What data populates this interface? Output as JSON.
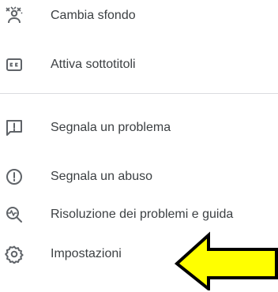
{
  "menu": {
    "items": [
      {
        "label": "Cambia sfondo",
        "icon": "change-background-icon"
      },
      {
        "label": "Attiva sottotitoli",
        "icon": "closed-captions-icon"
      },
      {
        "label": "Segnala un problema",
        "icon": "report-problem-icon"
      },
      {
        "label": "Segnala un abuso",
        "icon": "report-abuse-icon"
      },
      {
        "label": "Risoluzione dei problemi e guida",
        "icon": "troubleshooting-icon"
      },
      {
        "label": "Impostazioni",
        "icon": "settings-gear-icon"
      }
    ]
  },
  "annotation": {
    "icon": "left-pointing-arrow",
    "fill": "#ffff00",
    "stroke": "#000000"
  },
  "colors": {
    "text": "#3c4043",
    "icon": "#5f6368",
    "divider": "#dadce0"
  }
}
